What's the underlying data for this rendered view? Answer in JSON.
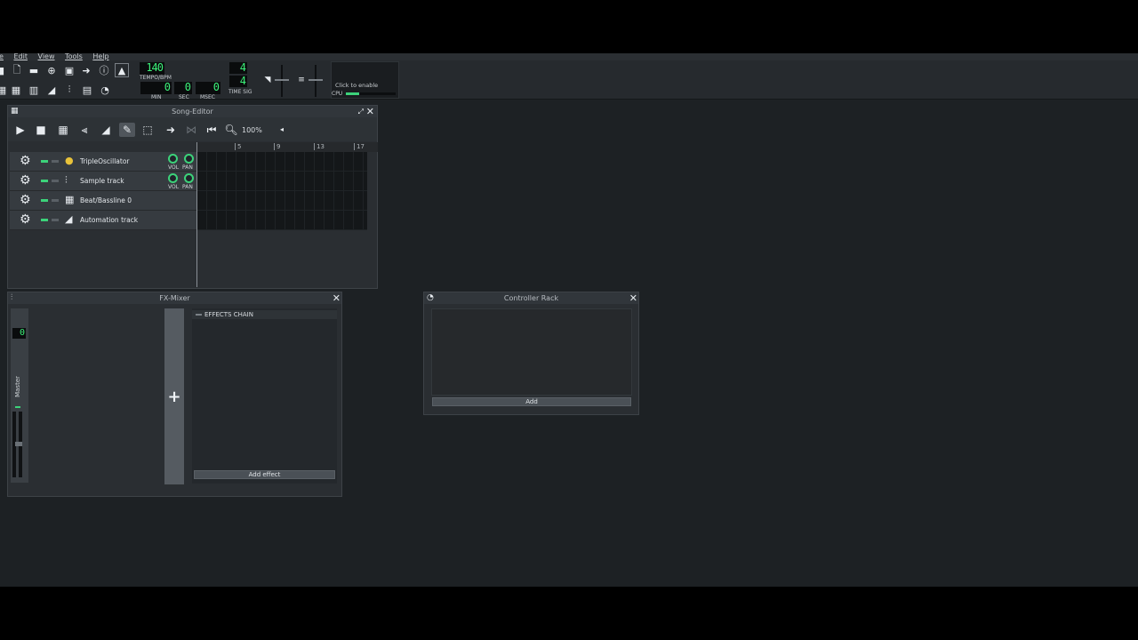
{
  "menubar": {
    "items": [
      "e",
      "Edit",
      "View",
      "Tools",
      "Help"
    ]
  },
  "toolbar": {
    "tempo_value": "140",
    "tempo_label": "TEMPO/BPM",
    "min_value": "0",
    "sec_value": "0",
    "msec_value": "0",
    "min_label": "MIN",
    "sec_label": "SEC",
    "msec_label": "MSEC",
    "timesig_num": "4",
    "timesig_den": "4",
    "timesig_label": "TIME SIG",
    "cpu_hint": "Click to enable",
    "cpu_label": "CPU",
    "cpu_load_fraction": 0.26
  },
  "song_editor": {
    "title": "Song-Editor",
    "zoom": "100%",
    "ruler_marks": [
      "5",
      "9",
      "13",
      "17"
    ],
    "tracks": [
      {
        "name": "TripleOscillator",
        "icon": "triple-oscillator-icon",
        "has_knobs": true
      },
      {
        "name": "Sample track",
        "icon": "waveform-icon",
        "has_knobs": true
      },
      {
        "name": "Beat/Bassline 0",
        "icon": "beat-grid-icon",
        "has_knobs": false
      },
      {
        "name": "Automation track",
        "icon": "automation-ramp-icon",
        "has_knobs": false
      }
    ],
    "vol_label": "VOL",
    "pan_label": "PAN"
  },
  "fx_mixer": {
    "title": "FX-Mixer",
    "channel_number": "0",
    "master_label": "Master",
    "effects_chain_label": "EFFECTS CHAIN",
    "add_effect_label": "Add effect",
    "add_channel_symbol": "+"
  },
  "controller_rack": {
    "title": "Controller Rack",
    "add_label": "Add"
  },
  "colors": {
    "accent_green": "#3cd27a",
    "lcd_green": "#3cf27a",
    "workspace_bg": "#1d2124"
  }
}
